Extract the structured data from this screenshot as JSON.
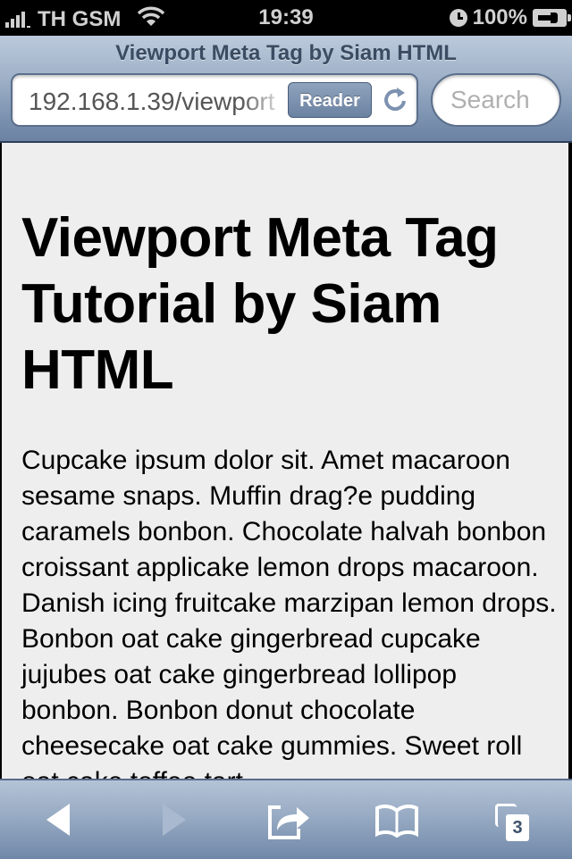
{
  "status_bar": {
    "carrier": "TH GSM",
    "time": "19:39",
    "battery_percent": "100%",
    "signal_bars": 4,
    "icons": [
      "signal-icon",
      "wifi-icon",
      "alarm-clock-icon",
      "battery-charging-icon"
    ]
  },
  "browser": {
    "page_title": "Viewport Meta Tag by Siam HTML",
    "url": "192.168.1.39/viewport",
    "reader_label": "Reader",
    "search_placeholder": "Search",
    "tab_count": "3",
    "toolbar_icons": [
      "back-icon",
      "forward-icon",
      "share-icon",
      "bookmarks-icon",
      "tabs-icon"
    ]
  },
  "page": {
    "heading": "Viewport Meta Tag Tutorial by Siam HTML",
    "paragraph": "Cupcake ipsum dolor sit. Amet macaroon sesame snaps. Muffin drag?e pudding caramels bonbon. Chocolate halvah bonbon croissant applicake lemon drops macaroon. Danish icing fruitcake marzipan lemon drops. Bonbon oat cake gingerbread cupcake jujubes oat cake gingerbread lollipop bonbon. Bonbon donut chocolate cheesecake oat cake gummies. Sweet roll oat cake toffee tart"
  },
  "colors": {
    "toolbar_top": "#b4c3d6",
    "toolbar_bottom": "#7088a8",
    "content_bg": "#eeeeee",
    "reader_button": "#7d92b0"
  }
}
